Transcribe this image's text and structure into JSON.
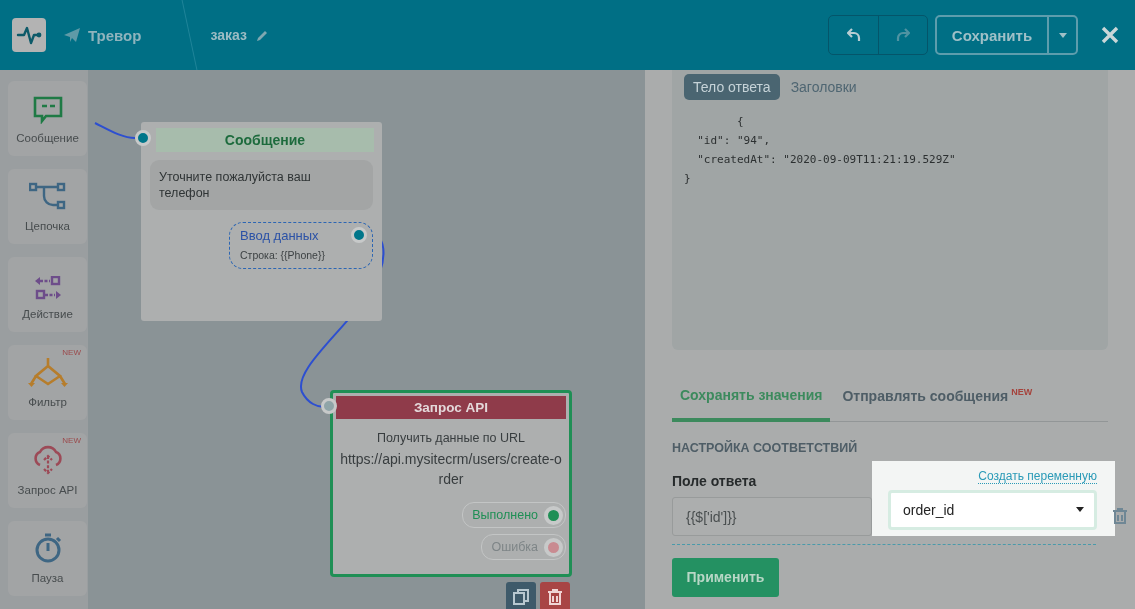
{
  "header": {
    "bot_name": "Тревор",
    "scenario_name": "заказ",
    "save_button": "Сохранить"
  },
  "palette": [
    {
      "kind": "message",
      "label": "Сообщение"
    },
    {
      "kind": "chain",
      "label": "Цепочка"
    },
    {
      "kind": "action",
      "label": "Действие"
    },
    {
      "kind": "filter",
      "label": "Фильтр",
      "badge": "NEW"
    },
    {
      "kind": "api",
      "label": "Запрос API",
      "badge": "NEW"
    },
    {
      "kind": "pause",
      "label": "Пауза"
    }
  ],
  "canvas": {
    "message_node": {
      "title": "Сообщение",
      "text": "Уточните пожалуйста ваш телефон",
      "input": {
        "title": "Ввод данных",
        "detail": "Строка: {{Phone}}"
      }
    },
    "api_node": {
      "title": "Запрос API",
      "description": "Получить данные по URL",
      "url": "https://api.mysitecrm/users/create-order",
      "outputs": [
        {
          "kind": "success",
          "label": "Выполнено",
          "color": "#1f8f55"
        },
        {
          "kind": "error",
          "label": "Ошибка",
          "color": "#c98b91"
        }
      ]
    }
  },
  "panel": {
    "response_tabs": [
      {
        "label": "Тело ответа",
        "selected": true
      },
      {
        "label": "Заголовки",
        "selected": false
      }
    ],
    "response_body": "        {\n  \"id\": \"94\",\n  \"createdAt\": \"2020-09-09T11:21:19.529Z\"\n}",
    "mapping_tabs": [
      {
        "label": "Сохранять значения",
        "selected": true
      },
      {
        "label": "Отправлять сообщения",
        "selected": false,
        "badge": "NEW"
      }
    ],
    "section_title": "НАСТРОЙКА СООТВЕТСТВИЙ",
    "field_label": "Поле ответа",
    "create_variable_link": "Создать переменную",
    "response_field": "{{$['id']}}",
    "variable_select": "order_id",
    "apply_button": "Применить"
  }
}
